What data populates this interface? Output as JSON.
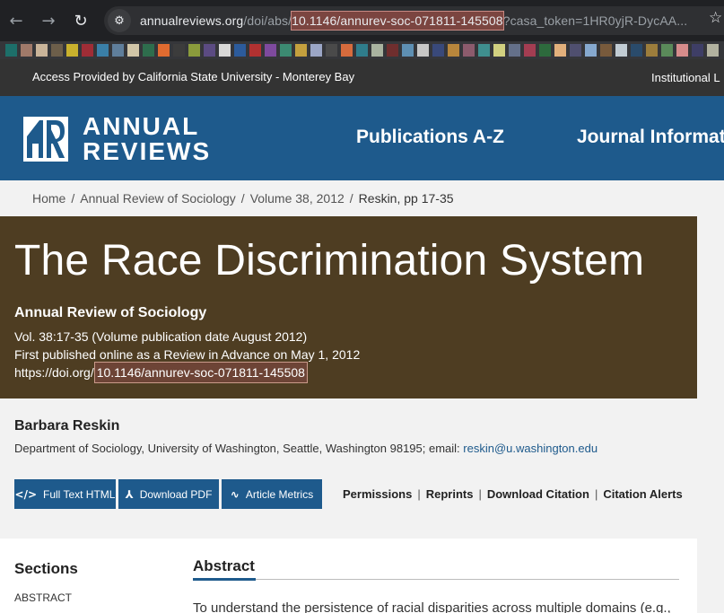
{
  "browser": {
    "url_host": "annualreviews.org",
    "url_path": "/doi/abs/",
    "url_highlight": "10.1146/annurev-soc-071811-145508",
    "url_rest": "?casa_token=1HR0yjR-DycAA...",
    "back_icon": "←",
    "forward_icon": "→",
    "reload_icon": "↻",
    "site_info_icon": "⚙",
    "star_icon": "☆"
  },
  "bookmark_colors": [
    "#1d6f6a",
    "#a07a6a",
    "#c9b49a",
    "#6c5e4a",
    "#c9b12d",
    "#9f2d36",
    "#3a7fa8",
    "#5f7e9b",
    "#d1c6a8",
    "#2e6d4d",
    "#e06b30",
    "#3c3c3c",
    "#8a9b3c",
    "#5b4b82",
    "#d8d8d8",
    "#2c5b9c",
    "#b13131",
    "#7e4a9e",
    "#3c8a72",
    "#c4a03e",
    "#9ba6c6",
    "#4a4a4a",
    "#d66b3d",
    "#2f7d8c",
    "#a9b3a0",
    "#6f2e2e",
    "#5e8fb3",
    "#c7c7c7",
    "#39497a",
    "#b8863c",
    "#8c5b6d",
    "#3f8f8f",
    "#d1d080",
    "#64708a",
    "#a33d52",
    "#2d6a3d",
    "#e2b07c",
    "#4f4f6f",
    "#86a9d0",
    "#785a3c",
    "#c1ccd4",
    "#2a4b6b",
    "#9c7d3c",
    "#5a8a5a",
    "#d68c8c",
    "#3e3e66",
    "#b2b2a0"
  ],
  "access": {
    "left": "Access Provided by California State University - Monterey Bay",
    "right": "Institutional L"
  },
  "header": {
    "logo_line1": "ANNUAL",
    "logo_line2": "REVIEWS",
    "nav": [
      "Publications A-Z",
      "Journal Informat"
    ]
  },
  "breadcrumb": {
    "items": [
      "Home",
      "Annual Review of Sociology",
      "Volume 38, 2012"
    ],
    "current": "Reskin, pp 17-35",
    "separator": "/"
  },
  "article": {
    "title": "The Race Discrimination System",
    "journal": "Annual Review of Sociology",
    "vol": "Vol. 38:17-35 (Volume publication date August 2012)",
    "first_published": "First published online as a Review in Advance on May 1, 2012",
    "doi_prefix": "https://doi.org/",
    "doi": "10.1146/annurev-soc-071811-145508"
  },
  "author": {
    "name": "Barbara Reskin",
    "affiliation": "Department of Sociology, University of Washington, Seattle, Washington 98195; email: ",
    "email": "reskin@u.washington.edu"
  },
  "actions": {
    "full_text": "Full Text HTML",
    "full_text_icon": "</>",
    "pdf": "Download PDF",
    "pdf_icon": "⅄",
    "metrics": "Article Metrics",
    "metrics_icon": "∿",
    "links": [
      "Permissions",
      "Reprints",
      "Download Citation",
      "Citation Alerts"
    ]
  },
  "content": {
    "sections_heading": "Sections",
    "sections_item": "ABSTRACT",
    "abstract_heading": "Abstract",
    "abstract_text": "To understand the persistence of racial disparities across multiple domains (e.g.,"
  }
}
